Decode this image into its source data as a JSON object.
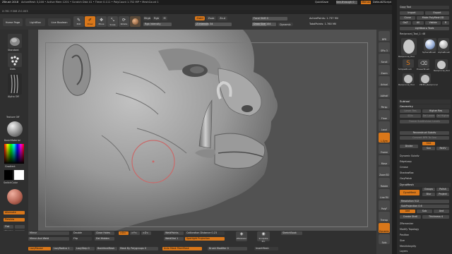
{
  "titlebar": {
    "app": "ZBrush 2018",
    "info": "ActiveMesh 3,246 • Active Mem 1201 • Scratch Disk 41 • Timer 0.111 • PolyCount 1.752 MP • MeshCount 1",
    "quicksave": "QuickSave",
    "seethrough": "See-through 0",
    "menus_label": "Menus",
    "script": "DefaultZScript"
  },
  "menubar": [
    "Alpha",
    "Brush",
    "Color",
    "Document",
    "Draw",
    "Edit",
    "File",
    "Layer",
    "Light",
    "Macro",
    "Marker",
    "Material",
    "Movie",
    "Picture",
    "Preferences",
    "Render",
    "Stencil",
    "Stroke",
    "Texture",
    "Tool",
    "Transform",
    "Zplugin",
    "Zscript",
    "Help"
  ],
  "status": "X:781 Y:308 Z:0.003",
  "toolbar": {
    "home_page": "Home Page",
    "lightbox": "LightBox",
    "live_boolean": "Live Boolean",
    "edit": "Edit",
    "draw": "Draw",
    "move": "Move",
    "scale": "Scale",
    "rotate": "Rotate",
    "mrgb": "Mrgb",
    "rgb": "Rgb",
    "m": "M",
    "rgb_intensity": "Rgb Intensity",
    "zadd": "Zadd",
    "zsub": "Zsub",
    "zcut": "Zcut",
    "z_intensity": "Z Intensity 34",
    "focal_shift": "Focal Shift 0",
    "draw_size": "Draw Size 104",
    "dynamic": "Dynamic",
    "active_points": "ActivePoints: 1.737 Mil",
    "total_points": "TotalPoints: 1.760 Mil"
  },
  "leftpanel": {
    "brush_label": "Standard",
    "stroke_label": "Dots",
    "alpha_label": "Alpha Off",
    "texture_label": "Texture Off",
    "material_label": "BasicMaterial",
    "gradient_label": "Gradient",
    "switch_color": "SwitchColor",
    "alternate": "Alternate",
    "preview": "Preview",
    "flat": "Flat",
    "cont": "Cont",
    "front": "Front",
    "right": "Right",
    "color_swatch": "#ffffff"
  },
  "rightshelf": [
    "BPR",
    "SPix 3",
    "Scroll",
    "Zoom",
    "Actual",
    "AAHalf",
    "Persp",
    "Floor",
    "Local",
    "L.Sym",
    "Frame",
    "Move",
    "Zoom3D",
    "Rotate",
    "Line Fill",
    "PolyF",
    "Transp",
    "Dynamic",
    "Solo"
  ],
  "rightpanel": {
    "copy_tool": "Copy Tool",
    "paste_tool": "Paste Tool",
    "import": "Import",
    "export": "Export",
    "clone": "Clone",
    "make_polymesh": "Make PolyMesh3D",
    "goz": "GoZ",
    "all": "All",
    "visible": "Visible",
    "r": "R",
    "lightbox_tools": "Lightbox ▸ Tools",
    "current_tool": "Reciprocal_Tool_1: 48",
    "thumbs": [
      "Reciprocal_Tool",
      "SphereBrush",
      "AlphaBrush",
      "SimpleBrush",
      "EraserBrush",
      "Reciprocal_Tool",
      "PM3D_Reciprocal",
      "Reciprocal_Tool"
    ],
    "subtool": "Subtool",
    "geometry": "Geometry",
    "lower_res": "Lower Res",
    "higher_res": "Higher Res",
    "sdiv": "SDiv",
    "del_lower": "Del Lower",
    "del_higher": "Del Higher",
    "freeze_subdiv": "Freeze SubDivision Levels",
    "reconstruct_subdiv": "Reconstruct Subdiv",
    "convert_bpr": "Convert BPR To Geo",
    "divide": "Divide",
    "smt": "Smt",
    "suv": "Suv",
    "rsuv": "ReUV",
    "dynamic_subdiv": "Dynamic Subdiv",
    "edgeloop": "EdgeLoop",
    "crease": "Crease",
    "shadowbox": "ShadowBox",
    "claypolish": "ClayPolish",
    "dynamesh_head": "DynaMesh",
    "dynamesh": "DynaMesh",
    "groups": "Groups",
    "polish": "Polish",
    "blur": "Blur",
    "project": "Project",
    "resolution": "Resolution 512",
    "subprojection": "SubProjection 0.6",
    "add": "Add",
    "sub": "Sub",
    "and": "And",
    "create_shell": "Create Shell",
    "thickness": "Thickness 4",
    "zremesher": "ZRemesher",
    "modify_topology": "Modify Topology",
    "position": "Position",
    "size": "Size",
    "meshintegrity": "MeshIntegrity",
    "layers": "Layers"
  },
  "bottombar": {
    "mirror": "Mirror",
    "mirror_weld": "Mirror And Weld",
    "double": "Double",
    "flip": "Flip",
    "close_holes": "Close Holes",
    "del_hidden": "Del Hidden",
    "x": ">X<",
    "y": ">Y<",
    "z": ">Z<",
    "weldpoints": "WeldPoints",
    "weld_dist": "WeldDist 1",
    "calibration": "Calibration Distance 0.23",
    "spotlight": "Spotlight Projection",
    "zmodeler": "ZModeler",
    "sculptris": "Sculptris Pro",
    "sketch": "SketchBook",
    "insert": "InsertMesh",
    "lazy_mouse": "LazyMouse",
    "lazy_radius": "LazyRadius 1",
    "lazy_step": "LazyStep 0",
    "backface": "BackfaceMask",
    "mask_polygroups": "Mask By Polygroups 0",
    "auto_mask": "Auto Mask FiberMask",
    "brush_modifier": "Brush Modifier 0"
  },
  "colors": {
    "accent": "#d9771a",
    "viewport": "#525252",
    "model": "#9a9a9a"
  }
}
